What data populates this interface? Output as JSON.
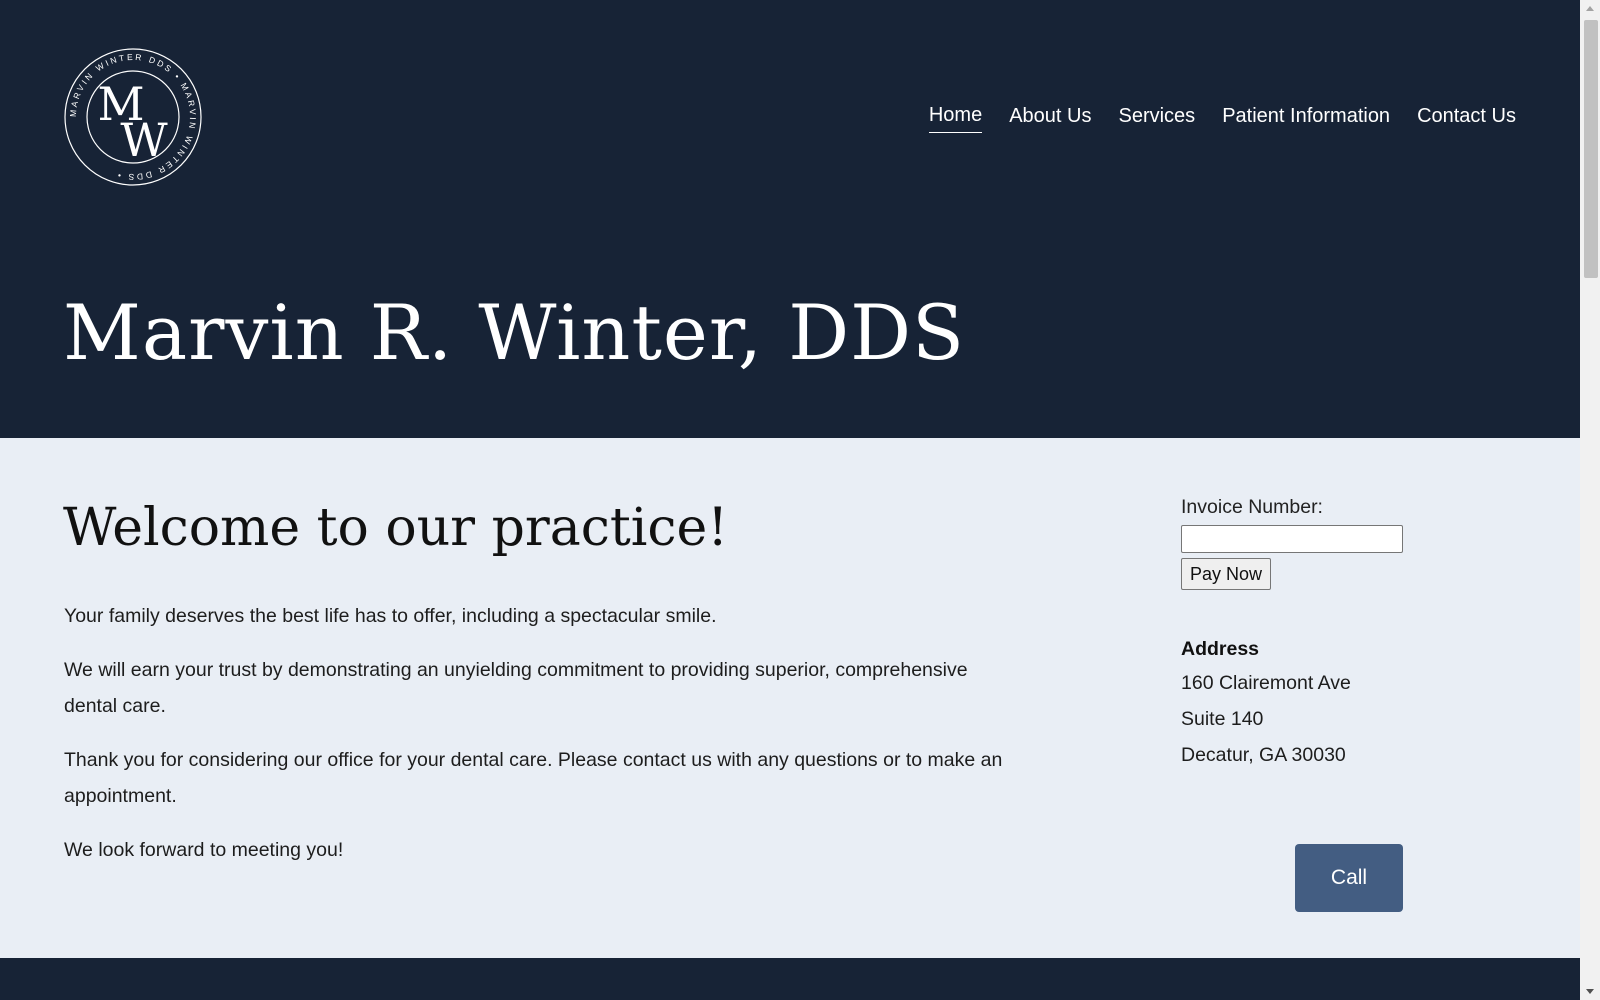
{
  "header": {
    "logo": {
      "monogram_top": "M",
      "monogram_bottom": "W",
      "ring_text": "MARVIN WINTER DDS • MARVIN WINTER DDS •"
    },
    "nav": [
      {
        "label": "Home",
        "active": true
      },
      {
        "label": "About Us",
        "active": false
      },
      {
        "label": "Services",
        "active": false
      },
      {
        "label": "Patient Information",
        "active": false
      },
      {
        "label": "Contact Us",
        "active": false
      }
    ],
    "site_title": "Marvin R. Winter, DDS"
  },
  "main": {
    "heading": "Welcome to our practice!",
    "paragraphs": [
      "Your family deserves the best life has to offer, including a spectacular smile.",
      "We will earn your trust by demonstrating an unyielding commitment to providing superior, comprehensive dental care.",
      "Thank you for considering our office for your dental care. Please contact us with any questions or to make an appointment.",
      "We look forward to meeting you!"
    ]
  },
  "sidebar": {
    "invoice_label": "Invoice Number:",
    "invoice_value": "",
    "pay_button": "Pay Now",
    "address_heading": "Address",
    "address_lines": [
      "160 Clairemont Ave",
      "Suite 140",
      "Decatur, GA 30030"
    ],
    "call_button": "Call"
  },
  "colors": {
    "header_bg": "#172336",
    "body_bg": "#e9eef5",
    "call_button_bg": "#435d82"
  }
}
